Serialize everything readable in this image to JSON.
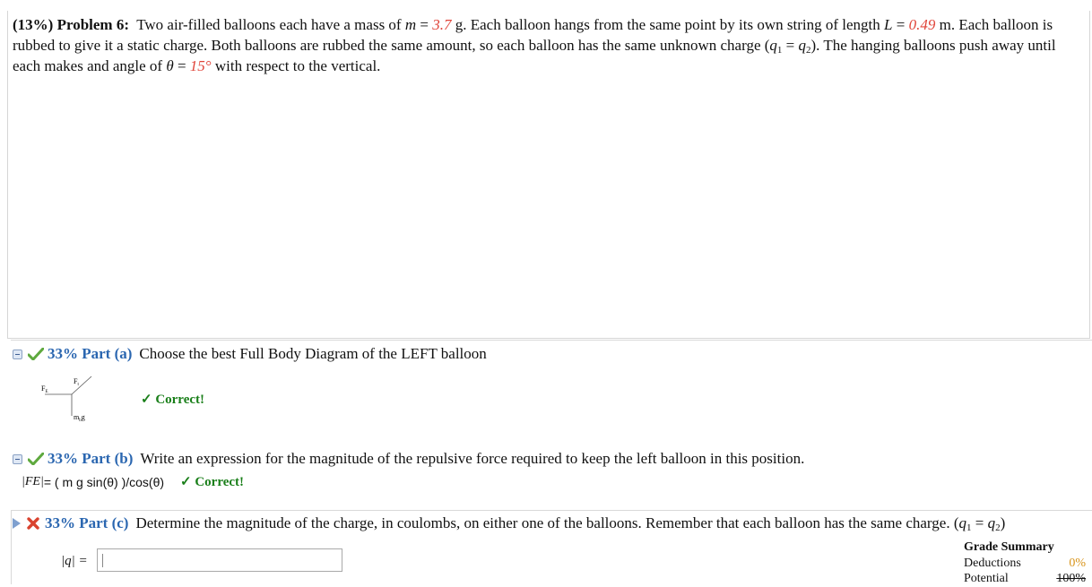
{
  "problem": {
    "header": "(13%) Problem 6:",
    "t1": "Two air-filled balloons each have a mass of ",
    "m_sym": "m",
    "m_val": "3.7",
    "t2": " g. Each balloon hangs from the same point by its own string of length ",
    "L_sym": "L",
    "L_val": "0.49",
    "t3": " m. Each balloon is rubbed to give it a static charge. Both balloons are rubbed the same amount, so each balloon has the same unknown charge (",
    "q1": "q",
    "q2": "q",
    "t4": "). The hanging balloons push away until each makes and angle of ",
    "theta_sym": "θ",
    "theta_val": "15°",
    "t5": " with respect to the vertical."
  },
  "part_a": {
    "percent_label": "33% Part (a)",
    "text": "Choose the best Full Body Diagram of the LEFT balloon",
    "feedback": "✓ Correct!",
    "diagram_labels": {
      "ft": "F",
      "ft_sub": "t",
      "fe": "F",
      "fe_sub": "E",
      "mg": "m",
      "mg_sub": "b",
      "mg_g": "g"
    }
  },
  "part_b": {
    "percent_label": "33% Part (b)",
    "text": "Write an expression for the magnitude of the repulsive force required to keep the left balloon in this position.",
    "lhs": "|F",
    "lhs_sub": "E",
    "lhs_end": "|",
    "expression": " = ( m g sin(θ) )/cos(θ)",
    "feedback": "✓ Correct!"
  },
  "part_c": {
    "percent_label": "33% Part (c)",
    "text": "Determine the magnitude of the charge, in coulombs, on either one of the balloons. Remember that each balloon has the same charge. (",
    "q1": "q",
    "q2": "q",
    "text_end": ")",
    "answer_label": "|q| =",
    "answer_value": ""
  },
  "grade_summary": {
    "title": "Grade Summary",
    "deductions_label": "Deductions",
    "deductions_value": "0%",
    "potential_label": "Potential",
    "potential_value": "100%"
  },
  "colors": {
    "accent": "#2a66b0",
    "given": "#e0453a",
    "correct": "#1a7f1a"
  }
}
